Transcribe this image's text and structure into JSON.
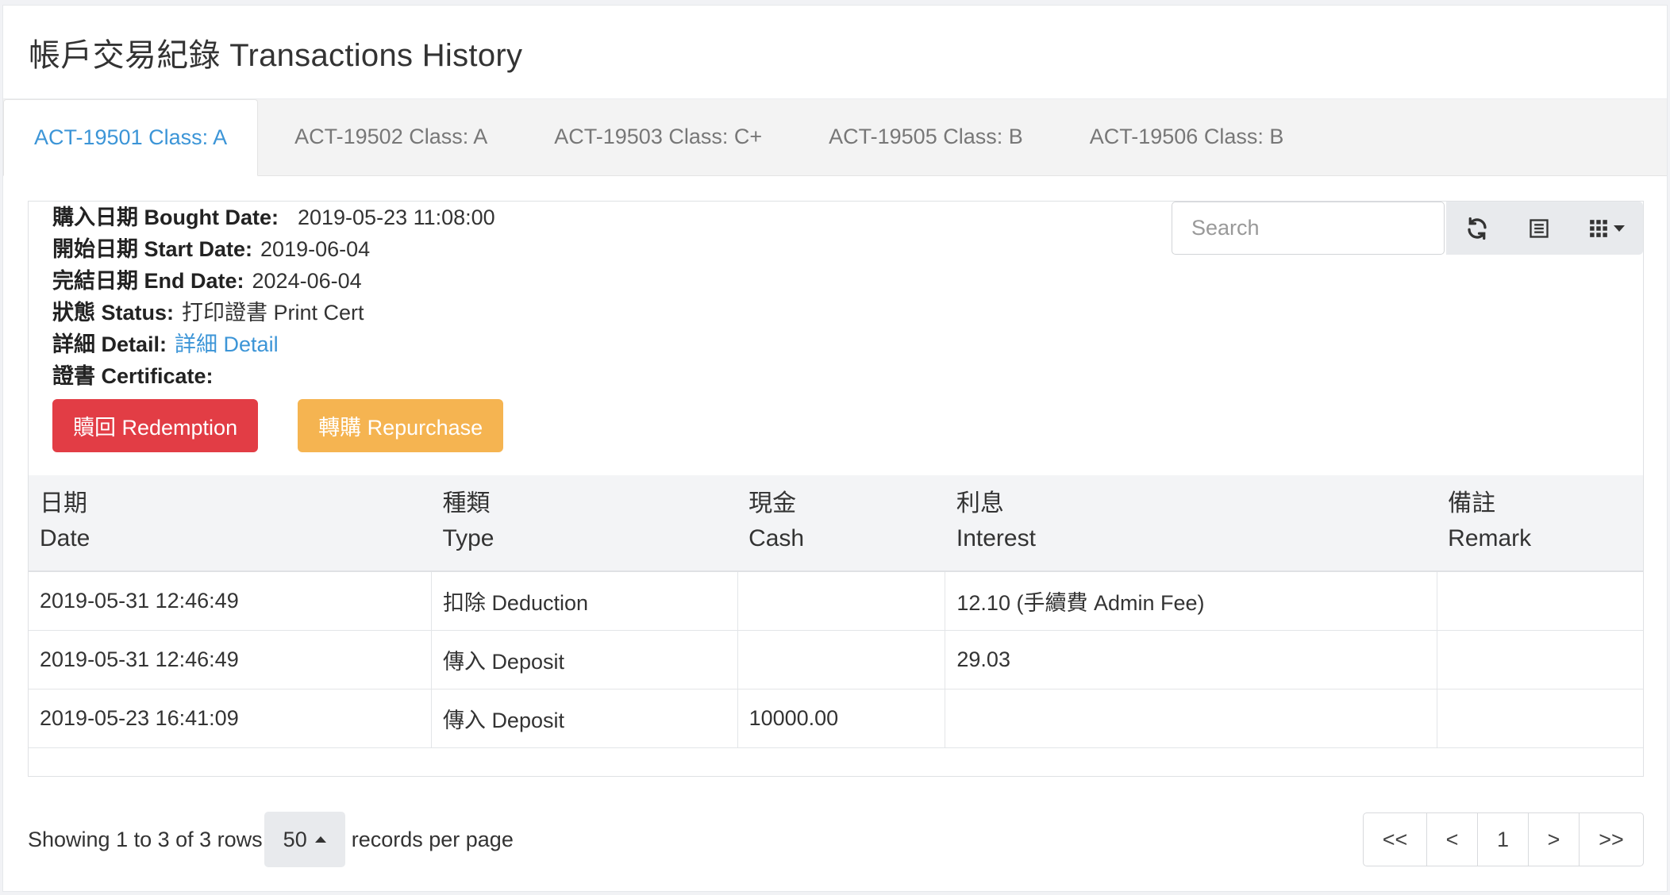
{
  "header": {
    "title": "帳戶交易紀錄 Transactions History"
  },
  "tabs": [
    {
      "label": "ACT-19501 Class: A",
      "active": true
    },
    {
      "label": "ACT-19502 Class: A",
      "active": false
    },
    {
      "label": "ACT-19503 Class: C+",
      "active": false
    },
    {
      "label": "ACT-19505 Class: B",
      "active": false
    },
    {
      "label": "ACT-19506 Class: B",
      "active": false
    }
  ],
  "details": {
    "bought_label": "購入日期 Bought Date:",
    "bought_value": "2019-05-23 11:08:00",
    "start_label": "開始日期 Start Date:",
    "start_value": "2019-06-04",
    "end_label": "完結日期 End Date:",
    "end_value": "2024-06-04",
    "status_label": "狀態 Status:",
    "status_value": "打印證書 Print Cert",
    "detail_label": "詳細 Detail:",
    "detail_link": "詳細 Detail",
    "certificate_label": "證書 Certificate:"
  },
  "actions": {
    "redemption": "贖回 Redemption",
    "repurchase": "轉購 Repurchase"
  },
  "toolbar": {
    "search_placeholder": "Search"
  },
  "table": {
    "columns": [
      {
        "zh": "日期",
        "en": "Date"
      },
      {
        "zh": "種類",
        "en": "Type"
      },
      {
        "zh": "現金",
        "en": "Cash"
      },
      {
        "zh": "利息",
        "en": "Interest"
      },
      {
        "zh": "備註",
        "en": "Remark"
      }
    ],
    "rows": [
      [
        "2019-05-31 12:46:49",
        "扣除 Deduction",
        "",
        "12.10 (手續費 Admin Fee)",
        ""
      ],
      [
        "2019-05-31 12:46:49",
        "傳入 Deposit",
        "",
        "29.03",
        ""
      ],
      [
        "2019-05-23 16:41:09",
        "傳入 Deposit",
        "10000.00",
        "",
        ""
      ]
    ]
  },
  "footer": {
    "showing": "Showing 1 to 3 of 3 rows",
    "page_size": "50",
    "per_page": "records per page"
  },
  "pagination": {
    "first": "<<",
    "prev": "<",
    "current": "1",
    "next": ">",
    "last": ">>"
  },
  "colors": {
    "accent": "#3c95d7",
    "danger": "#e23d45",
    "warning": "#f5b451"
  },
  "icons": [
    "refresh-icon",
    "list-view-icon",
    "columns-grid-icon"
  ]
}
